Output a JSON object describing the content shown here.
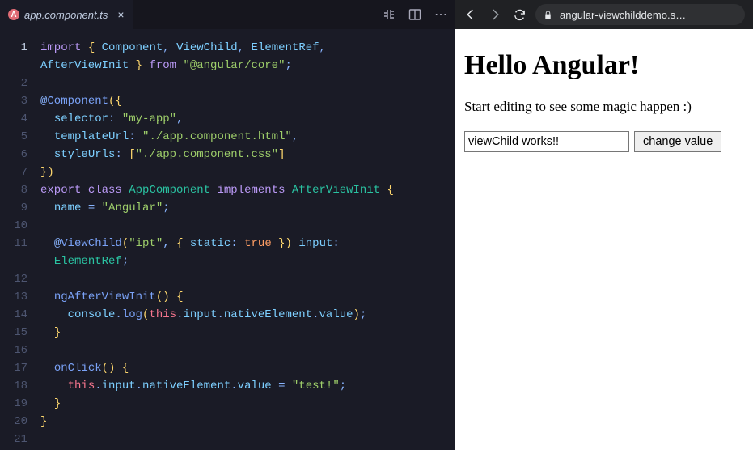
{
  "editor": {
    "tab": {
      "filename": "app.component.ts",
      "icon_letter": "A"
    },
    "active_line": 1,
    "lines": [
      {
        "n": 1,
        "html": "<span class='kw-import'>import</span> <span class='brace'>{</span> <span class='ident'>Component</span><span class='punct'>,</span> <span class='ident'>ViewChild</span><span class='punct'>,</span> <span class='ident'>ElementRef</span><span class='punct'>,</span>"
      },
      {
        "n": "",
        "html": "<span class='ident'>AfterViewInit</span> <span class='brace'>}</span> <span class='kw-from'>from</span> <span class='str'>\"@angular/core\"</span><span class='punct'>;</span>"
      },
      {
        "n": 2,
        "html": ""
      },
      {
        "n": 3,
        "html": "<span class='punct'>@</span><span class='decor'>Component</span><span class='paren'>(</span><span class='brace'>{</span>"
      },
      {
        "n": 4,
        "html": "  <span class='prop'>selector</span><span class='punct'>:</span> <span class='str'>\"my-app\"</span><span class='punct'>,</span>"
      },
      {
        "n": 5,
        "html": "  <span class='prop'>templateUrl</span><span class='punct'>:</span> <span class='str'>\"./app.component.html\"</span><span class='punct'>,</span>"
      },
      {
        "n": 6,
        "html": "  <span class='prop'>styleUrls</span><span class='punct'>:</span> <span class='square'>[</span><span class='str'>\"./app.component.css\"</span><span class='square'>]</span>"
      },
      {
        "n": 7,
        "html": "<span class='brace'>}</span><span class='paren'>)</span>"
      },
      {
        "n": 8,
        "html": "<span class='kw-export'>export</span> <span class='kw-class'>class</span> <span class='classnm'>AppComponent</span> <span class='kw-impl'>implements</span> <span class='type'>AfterViewInit</span> <span class='brace'>{</span>"
      },
      {
        "n": 9,
        "html": "  <span class='ident'>name</span> <span class='punct'>=</span> <span class='str'>\"Angular\"</span><span class='punct'>;</span>"
      },
      {
        "n": 10,
        "html": ""
      },
      {
        "n": 11,
        "html": "  <span class='punct'>@</span><span class='decor'>ViewChild</span><span class='paren'>(</span><span class='str'>\"ipt\"</span><span class='punct'>,</span> <span class='brace'>{</span> <span class='prop'>static</span><span class='punct'>:</span> <span class='kw-true'>true</span> <span class='brace'>}</span><span class='paren'>)</span> <span class='ident'>input</span><span class='punct'>:</span>"
      },
      {
        "n": "",
        "html": "  <span class='type'>ElementRef</span><span class='punct'>;</span>"
      },
      {
        "n": 12,
        "html": ""
      },
      {
        "n": 13,
        "html": "  <span class='method'>ngAfterViewInit</span><span class='paren'>()</span> <span class='brace'>{</span>"
      },
      {
        "n": 14,
        "html": "    <span class='ident'>console</span><span class='punct'>.</span><span class='method'>log</span><span class='paren'>(</span><span class='kw-this'>this</span><span class='punct'>.</span><span class='ident'>input</span><span class='punct'>.</span><span class='ident'>nativeElement</span><span class='punct'>.</span><span class='ident'>value</span><span class='paren'>)</span><span class='punct'>;</span>"
      },
      {
        "n": 15,
        "html": "  <span class='brace'>}</span>"
      },
      {
        "n": 16,
        "html": ""
      },
      {
        "n": 17,
        "html": "  <span class='method'>onClick</span><span class='paren'>()</span> <span class='brace'>{</span>"
      },
      {
        "n": 18,
        "html": "    <span class='kw-this'>this</span><span class='punct'>.</span><span class='ident'>input</span><span class='punct'>.</span><span class='ident'>nativeElement</span><span class='punct'>.</span><span class='ident'>value</span> <span class='punct'>=</span> <span class='str'>\"test!\"</span><span class='punct'>;</span>"
      },
      {
        "n": 19,
        "html": "  <span class='brace'>}</span>"
      },
      {
        "n": 20,
        "html": "<span class='brace'>}</span>"
      },
      {
        "n": 21,
        "html": ""
      }
    ]
  },
  "browser": {
    "url_display": "angular-viewchilddemo.s…",
    "page": {
      "heading": "Hello Angular!",
      "subtext": "Start editing to see some magic happen :)",
      "input_value": "viewChild works!!",
      "button_label": "change value"
    }
  }
}
